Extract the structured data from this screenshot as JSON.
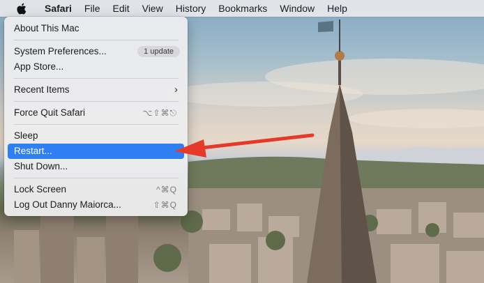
{
  "menubar": {
    "apple_icon": "apple-icon",
    "items": [
      "Safari",
      "File",
      "Edit",
      "View",
      "History",
      "Bookmarks",
      "Window",
      "Help"
    ]
  },
  "apple_menu": {
    "about": "About This Mac",
    "system_prefs": "System Preferences...",
    "update_badge": "1 update",
    "app_store": "App Store...",
    "recent_items": "Recent Items",
    "force_quit": "Force Quit Safari",
    "force_quit_shortcut": "⌥⇧⌘⎋",
    "sleep": "Sleep",
    "restart": "Restart...",
    "shut_down": "Shut Down...",
    "lock_screen": "Lock Screen",
    "lock_shortcut": "^⌘Q",
    "log_out": "Log Out Danny Maiorca...",
    "log_out_shortcut": "⇧⌘Q"
  },
  "colors": {
    "highlight": "#2f7ff3",
    "arrow": "#e53a2a"
  }
}
